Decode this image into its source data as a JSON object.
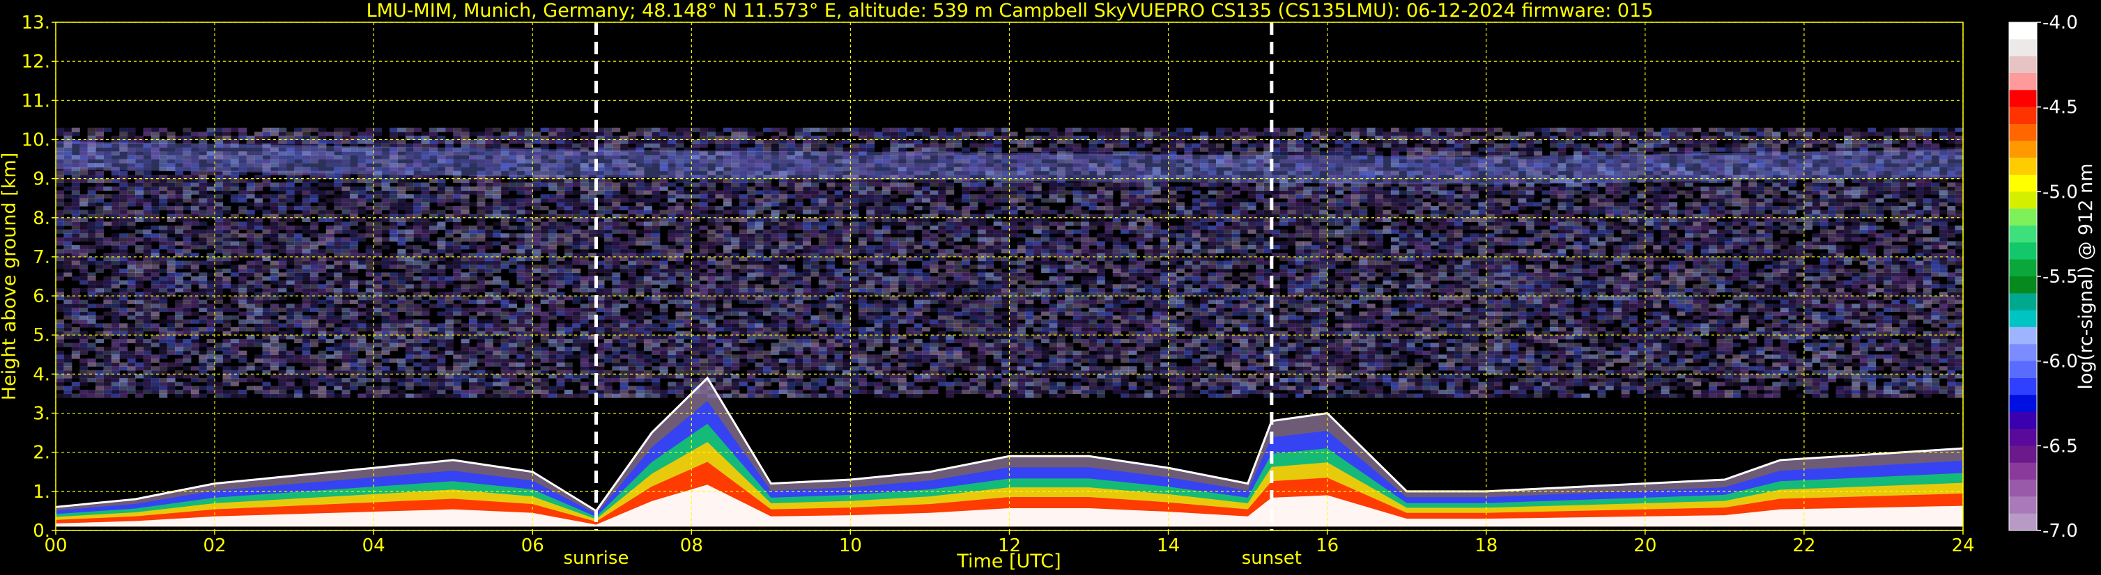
{
  "chart_data": {
    "type": "heatmap",
    "title": "LMU-MIM, Munich, Germany; 48.148° N 11.573° E, altitude: 539 m    Campbell SkyVUEPRO CS135 (CS135LMU): 06-12-2024    firmware: 015",
    "xlabel": "Time [UTC]",
    "ylabel": "Height above ground [km]",
    "xlim": [
      0,
      24
    ],
    "ylim": [
      0,
      13
    ],
    "x_ticks": [
      "00",
      "02",
      "04",
      "06",
      "08",
      "10",
      "12",
      "14",
      "16",
      "18",
      "20",
      "22",
      "24"
    ],
    "y_ticks": [
      "0.",
      "1.",
      "2.",
      "3.",
      "4.",
      "5.",
      "6.",
      "7.",
      "8.",
      "9.",
      "10.",
      "11.",
      "12.",
      "13."
    ],
    "grid": true,
    "grid_color": "#ffff00",
    "annotations": [
      {
        "label": "sunrise",
        "time": 6.8
      },
      {
        "label": "sunset",
        "time": 15.3
      }
    ],
    "colorbar": {
      "label": "log(rc-signal) @ 912 nm",
      "range": [
        -7.0,
        -4.0
      ],
      "tick_labels": [
        "-4.0",
        "-4.5",
        "-5.0",
        "-5.5",
        "-6.0",
        "-6.5",
        "-7.0"
      ],
      "tick_values": [
        -4.0,
        -4.5,
        -5.0,
        -5.5,
        -6.0,
        -6.5,
        -7.0
      ],
      "colors": [
        "#ffffff",
        "#ede9e9",
        "#e6c4c4",
        "#ff9a9a",
        "#ff0000",
        "#ff3300",
        "#ff6600",
        "#ff9900",
        "#ffcc00",
        "#ffff00",
        "#d4f000",
        "#7df05a",
        "#3de07a",
        "#12c86a",
        "#0aa83a",
        "#068a1e",
        "#00a890",
        "#00c4c4",
        "#9fb4ff",
        "#7b8cff",
        "#5a6cff",
        "#3040ff",
        "#0010e0",
        "#3a00b0",
        "#5a0a9a",
        "#6a1a8a",
        "#8a3a9a",
        "#9a5aaa",
        "#aa7ab8",
        "#b89ac6"
      ]
    },
    "cloud_layers": [
      {
        "name": "low-boundary-layer",
        "points": [
          [
            0.0,
            0.6
          ],
          [
            1.0,
            0.8
          ],
          [
            2.0,
            1.2
          ],
          [
            3.0,
            1.4
          ],
          [
            4.0,
            1.6
          ],
          [
            5.0,
            1.8
          ],
          [
            6.0,
            1.5
          ],
          [
            6.8,
            0.5
          ],
          [
            7.5,
            2.5
          ],
          [
            8.2,
            3.9
          ],
          [
            9.0,
            1.2
          ],
          [
            10.0,
            1.3
          ],
          [
            11.0,
            1.5
          ],
          [
            12.0,
            1.9
          ],
          [
            13.0,
            1.9
          ],
          [
            14.0,
            1.6
          ],
          [
            15.0,
            1.2
          ],
          [
            15.3,
            2.8
          ],
          [
            16.0,
            3.0
          ],
          [
            17.0,
            1.0
          ],
          [
            18.0,
            1.0
          ],
          [
            19.0,
            1.1
          ],
          [
            20.0,
            1.2
          ],
          [
            21.0,
            1.3
          ],
          [
            21.7,
            1.8
          ],
          [
            22.5,
            1.9
          ],
          [
            24.0,
            2.1
          ]
        ]
      },
      {
        "name": "upper-cirrus",
        "points": [
          [
            0.0,
            9.6
          ],
          [
            6.0,
            9.4
          ],
          [
            12.0,
            9.3
          ],
          [
            18.0,
            9.2
          ],
          [
            24.0,
            9.4
          ]
        ]
      }
    ]
  }
}
